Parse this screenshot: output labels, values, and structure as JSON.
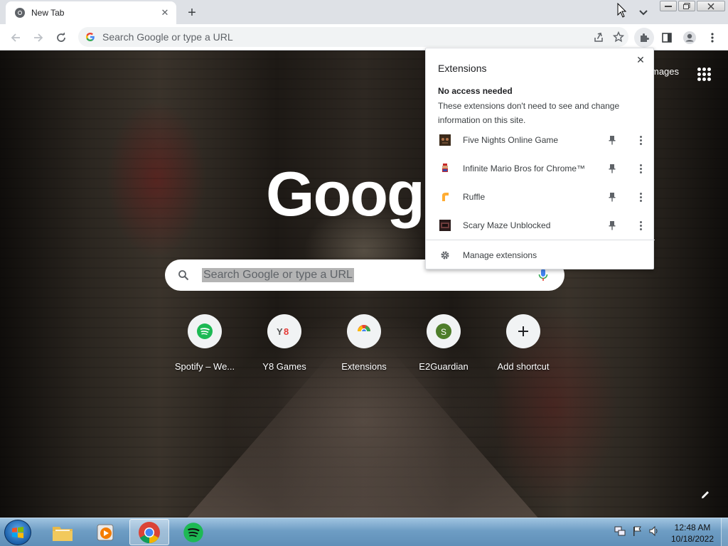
{
  "browser": {
    "tab_title": "New Tab",
    "omnibox_placeholder": "Search Google or type a URL"
  },
  "ntp": {
    "images_link": "mages",
    "logo_text": "Googl",
    "search_placeholder": "Search Google or type a URL",
    "shortcuts": [
      {
        "label": "Spotify – We...",
        "icon": "spotify-icon"
      },
      {
        "label": "Y8 Games",
        "icon": "y8-icon"
      },
      {
        "label": "Extensions",
        "icon": "chrome-web-store-icon"
      },
      {
        "label": "E2Guardian",
        "icon": "e2guardian-icon",
        "letter": "S"
      },
      {
        "label": "Add shortcut",
        "icon": "add-icon"
      }
    ]
  },
  "extensions_popup": {
    "title": "Extensions",
    "section_heading": "No access needed",
    "section_description": "These extensions don't need to see and change information on this site.",
    "items": [
      {
        "name": "Five Nights Online Game",
        "icon": "five-nights-icon"
      },
      {
        "name": "Infinite Mario Bros for Chrome™",
        "icon": "mario-icon"
      },
      {
        "name": "Ruffle",
        "icon": "ruffle-icon"
      },
      {
        "name": "Scary Maze Unblocked",
        "icon": "scary-maze-icon"
      }
    ],
    "manage_label": "Manage extensions"
  },
  "taskbar": {
    "time": "12:48 AM",
    "date": "10/18/2022"
  },
  "colors": {
    "accent_blue": "#1a73e8",
    "spotify_green": "#1db954",
    "taskbar_blue": "#6e9dc4"
  }
}
